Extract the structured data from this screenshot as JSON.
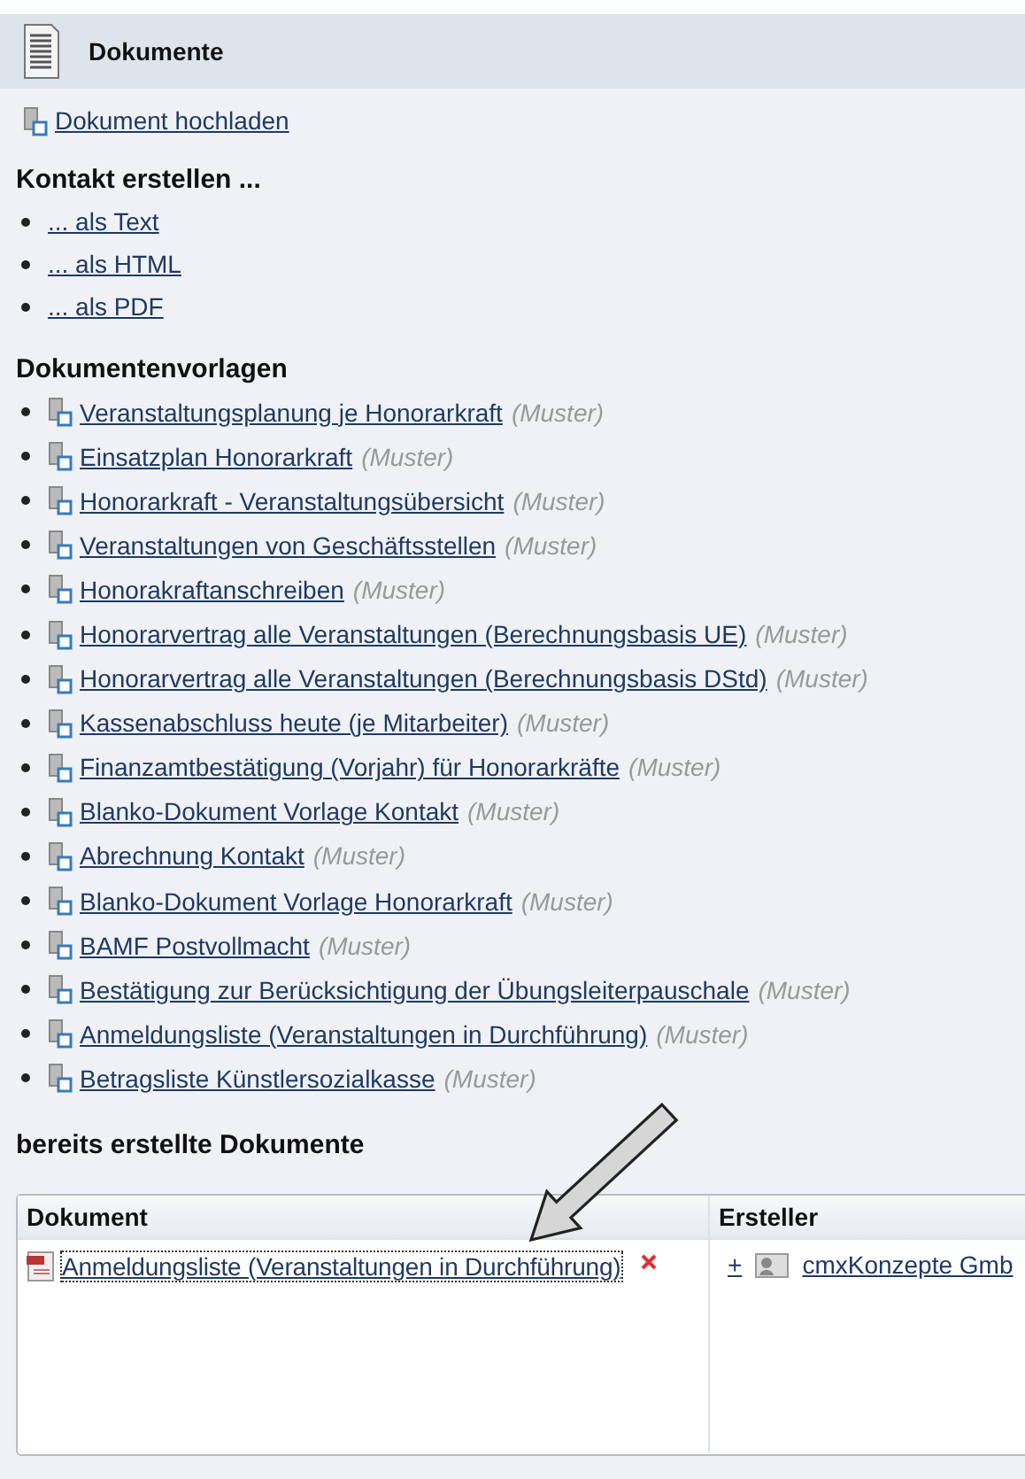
{
  "header": {
    "title": "Dokumente"
  },
  "upload_link": "Dokument hochladen",
  "contact": {
    "heading": "Kontakt erstellen ...",
    "links": [
      "... als Text",
      "... als HTML",
      "... als PDF"
    ]
  },
  "templates": {
    "heading": "Dokumentenvorlagen",
    "items": [
      {
        "label": "Veranstaltungsplanung je Honorarkraft",
        "note": "(Muster)"
      },
      {
        "label": "Einsatzplan Honorarkraft",
        "note": "(Muster)"
      },
      {
        "label": "Honorarkraft - Veranstaltungsübersicht",
        "note": "(Muster)"
      },
      {
        "label": "Veranstaltungen von Geschäftsstellen",
        "note": "(Muster)"
      },
      {
        "label": "Honorakraftanschreiben",
        "note": "(Muster)"
      },
      {
        "label": "Honorarvertrag alle Veranstaltungen (Berechnungsbasis UE)",
        "note": "(Muster)"
      },
      {
        "label": "Honorarvertrag alle Veranstaltungen (Berechnungsbasis DStd)",
        "note": "(Muster)"
      },
      {
        "label": "Kassenabschluss heute (je Mitarbeiter)",
        "note": "(Muster)"
      },
      {
        "label": "Finanzamtbestätigung (Vorjahr) für Honorarkräfte",
        "note": "(Muster)"
      },
      {
        "label": "Blanko-Dokument Vorlage Kontakt",
        "note": "(Muster)"
      },
      {
        "label": "Abrechnung Kontakt",
        "note": "(Muster)"
      },
      {
        "label": "Blanko-Dokument Vorlage Honorarkraft",
        "note": "(Muster)"
      },
      {
        "label": "BAMF Postvollmacht",
        "note": "(Muster)"
      },
      {
        "label": "Bestätigung zur Berücksichtigung der Übungsleiterpauschale",
        "note": "(Muster)"
      },
      {
        "label": "Anmeldungsliste (Veranstaltungen in Durchführung)",
        "note": "(Muster)"
      },
      {
        "label": "Betragsliste Künstlersozialkasse",
        "note": "(Muster)"
      }
    ]
  },
  "created": {
    "heading": "bereits erstellte Dokumente",
    "columns": [
      "Dokument",
      "Ersteller"
    ],
    "rows": [
      {
        "document": "Anmeldungsliste (Veranstaltungen in Durchführung)",
        "focused": true,
        "expand": "+",
        "creator": "cmxKonzepte Gmb"
      }
    ]
  }
}
